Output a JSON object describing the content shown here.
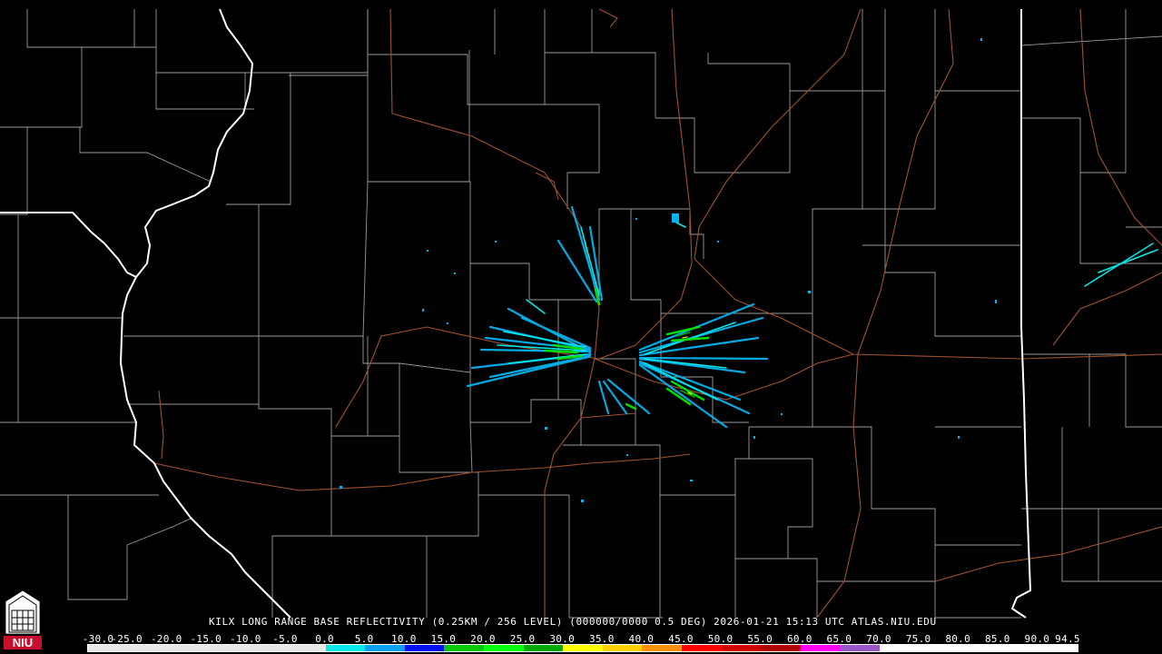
{
  "caption": "KILX LONG RANGE BASE REFLECTIVITY (0.25KM / 256 LEVEL) (000000/0000 0.5 DEG) 2026-01-21 15:13 UTC  ATLAS.NIU.EDU",
  "scale": {
    "labels": [
      "-30.0",
      "-25.0",
      "-20.0",
      "-15.0",
      "-10.0",
      "-5.0",
      "0.0",
      "5.0",
      "10.0",
      "15.0",
      "20.0",
      "25.0",
      "30.0",
      "35.0",
      "40.0",
      "45.0",
      "50.0",
      "55.0",
      "60.0",
      "65.0",
      "70.0",
      "75.0",
      "80.0",
      "85.0",
      "90.0",
      "94.5"
    ],
    "colors": [
      "#e8e8e8",
      "#e8e8e8",
      "#e8e8e8",
      "#e8e8e8",
      "#e8e8e8",
      "#e8e8e8",
      "#00e8e8",
      "#00a0f0",
      "#0010f0",
      "#00c800",
      "#00ff00",
      "#00a800",
      "#ffff00",
      "#ffd000",
      "#ff9000",
      "#ff0000",
      "#d00000",
      "#b00000",
      "#ff00ff",
      "#9a55c9",
      "#ffffff",
      "#ffffff",
      "#ffffff",
      "#ffffff",
      "#ffffff"
    ]
  },
  "logo": {
    "text": "NIU",
    "color": "#c8102e"
  }
}
